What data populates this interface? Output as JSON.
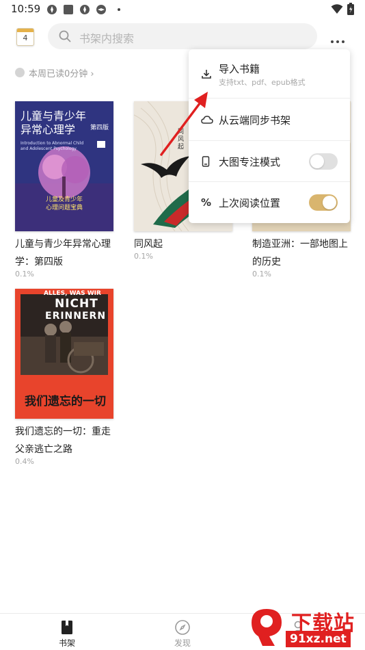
{
  "status_bar": {
    "time": "10:59"
  },
  "header": {
    "calendar_day": "4",
    "search": {
      "placeholder": "书架内搜索"
    }
  },
  "weekly_reading": {
    "text": "本周已读0分钟 ›"
  },
  "books": [
    {
      "title": "儿童与青少年异常心理学：第四版",
      "progress": "0.1%",
      "cover": {
        "heading": "儿童与青少年\n异常心理学",
        "subheading": "Introduction to Abnormal Child and Adolescent Psychology",
        "edition": "第四版",
        "tagline": "儿童及青少年\n心理问题宝典",
        "color": "#3a3a8c"
      }
    },
    {
      "title": "同风起",
      "progress": "0.1%",
      "cover": {
        "spine_text": "同风起",
        "color": "#ece6dc"
      }
    },
    {
      "title": "制造亚洲：一部地图上的历史",
      "progress": "0.1%",
      "cover": {
        "color": "#efe3cc"
      }
    },
    {
      "title": "我们遗忘的一切：重走父亲逃亡之路",
      "progress": "0.4%",
      "cover": {
        "heading_de_1": "ALLES, WAS WIR",
        "heading_de_2": "NICHT",
        "heading_de_3": "ERINNERN",
        "heading_cn": "我们遗忘的一切",
        "color": "#e8442c"
      }
    }
  ],
  "menu": {
    "items": [
      {
        "label": "导入书籍",
        "sub": "支持txt、pdf、epub格式",
        "icon": "download-icon"
      },
      {
        "label": "从云端同步书架",
        "icon": "cloud-icon"
      },
      {
        "label": "大图专注模式",
        "icon": "phone-icon",
        "toggle": false
      },
      {
        "label": "上次阅读位置",
        "icon": "percent-icon",
        "icon_text": "%",
        "toggle": true
      }
    ]
  },
  "tabs": [
    {
      "label": "书架",
      "active": true,
      "icon": "bookshelf-icon"
    },
    {
      "label": "发现",
      "active": false,
      "icon": "compass-icon"
    },
    {
      "label": "我的",
      "active": false,
      "icon": "profile-icon"
    }
  ],
  "watermark": {
    "brand": "下载站",
    "url": "91xz.net"
  },
  "colors": {
    "accent": "#d9b56e",
    "toggle_off": "#e0e0e0",
    "arrow": "#e02020",
    "watermark": "#e02020"
  }
}
